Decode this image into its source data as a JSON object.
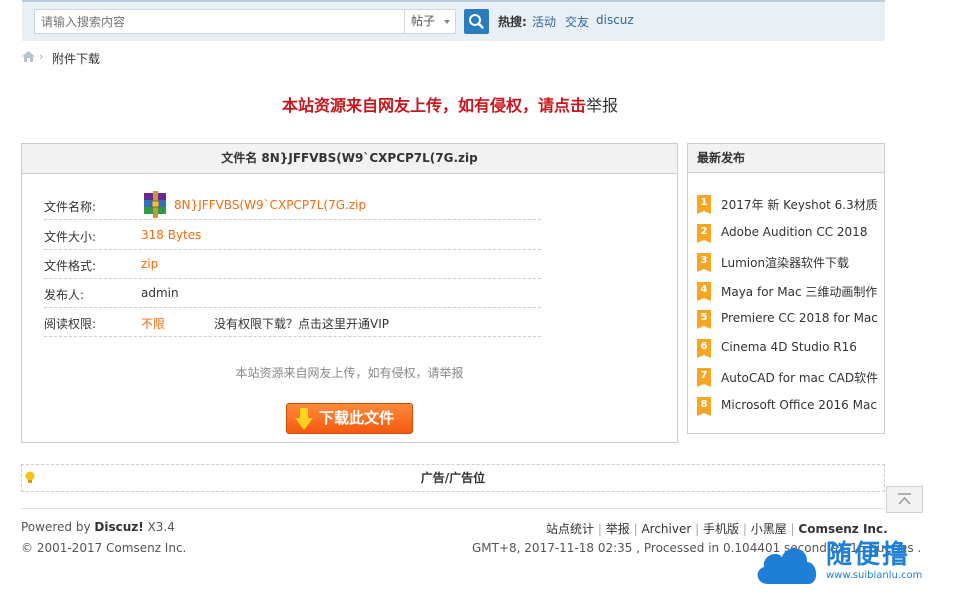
{
  "search": {
    "placeholder": "请输入搜索内容",
    "type": "帖子",
    "hot_label": "热搜:",
    "hot_items": [
      "活动",
      "交友",
      "discuz"
    ]
  },
  "breadcrumb": {
    "current": "附件下载"
  },
  "notice": {
    "red": "本站资源来自网友上传，如有侵权，请点击",
    "tail": "举报"
  },
  "file_panel": {
    "title": "文件名  8N}JFFVBS(W9`CXPCP7L(7G.zip",
    "rows": [
      {
        "label": "文件名称:",
        "value": "8N}JFFVBS(W9`CXPCP7L(7G.zip"
      },
      {
        "label": "文件大小:",
        "value": "318 Bytes"
      },
      {
        "label": "文件格式:",
        "value": "zip"
      },
      {
        "label": "发布人:",
        "value": "admin"
      },
      {
        "label": "阅读权限:",
        "value": "不限",
        "extra": "没有权限下载？点击这里开通VIP"
      }
    ],
    "disclaimer": "本站资源来自网友上传，如有侵权，请举报",
    "download_label": "下载此文件"
  },
  "sidebar": {
    "title": "最新发布",
    "items": [
      {
        "num": "1",
        "title": "2017年 新 Keyshot 6.3材质"
      },
      {
        "num": "2",
        "title": "Adobe Audition CC 2018"
      },
      {
        "num": "3",
        "title": "Lumion渲染器软件下载"
      },
      {
        "num": "4",
        "title": "Maya for Mac 三维动画制作"
      },
      {
        "num": "5",
        "title": "Premiere CC 2018 for Mac"
      },
      {
        "num": "6",
        "title": "Cinema 4D Studio R16"
      },
      {
        "num": "7",
        "title": "AutoCAD for mac CAD软件"
      },
      {
        "num": "8",
        "title": "Microsoft Office 2016 Mac"
      }
    ]
  },
  "ad": {
    "label": "广告/广告位"
  },
  "footer": {
    "powered_prefix": "Powered by ",
    "powered_brand": "Discuz!",
    "powered_version": " X3.4",
    "copyright": "© 2001-2017 Comsenz Inc.",
    "links": [
      "站点统计",
      "举报",
      "Archiver",
      "手机版",
      "小黑屋"
    ],
    "company": "Comsenz Inc.",
    "info": "GMT+8, 2017-11-18 02:35 , Processed in 0.104401 second(s), 16 queries ."
  },
  "watermark": {
    "text": "随便撸",
    "url": "www.suibianlu.com"
  },
  "colors": {
    "accent": "#2b7bbf",
    "notice": "#c8161d",
    "orange": "#f26c11",
    "badge": "#f6a623"
  }
}
